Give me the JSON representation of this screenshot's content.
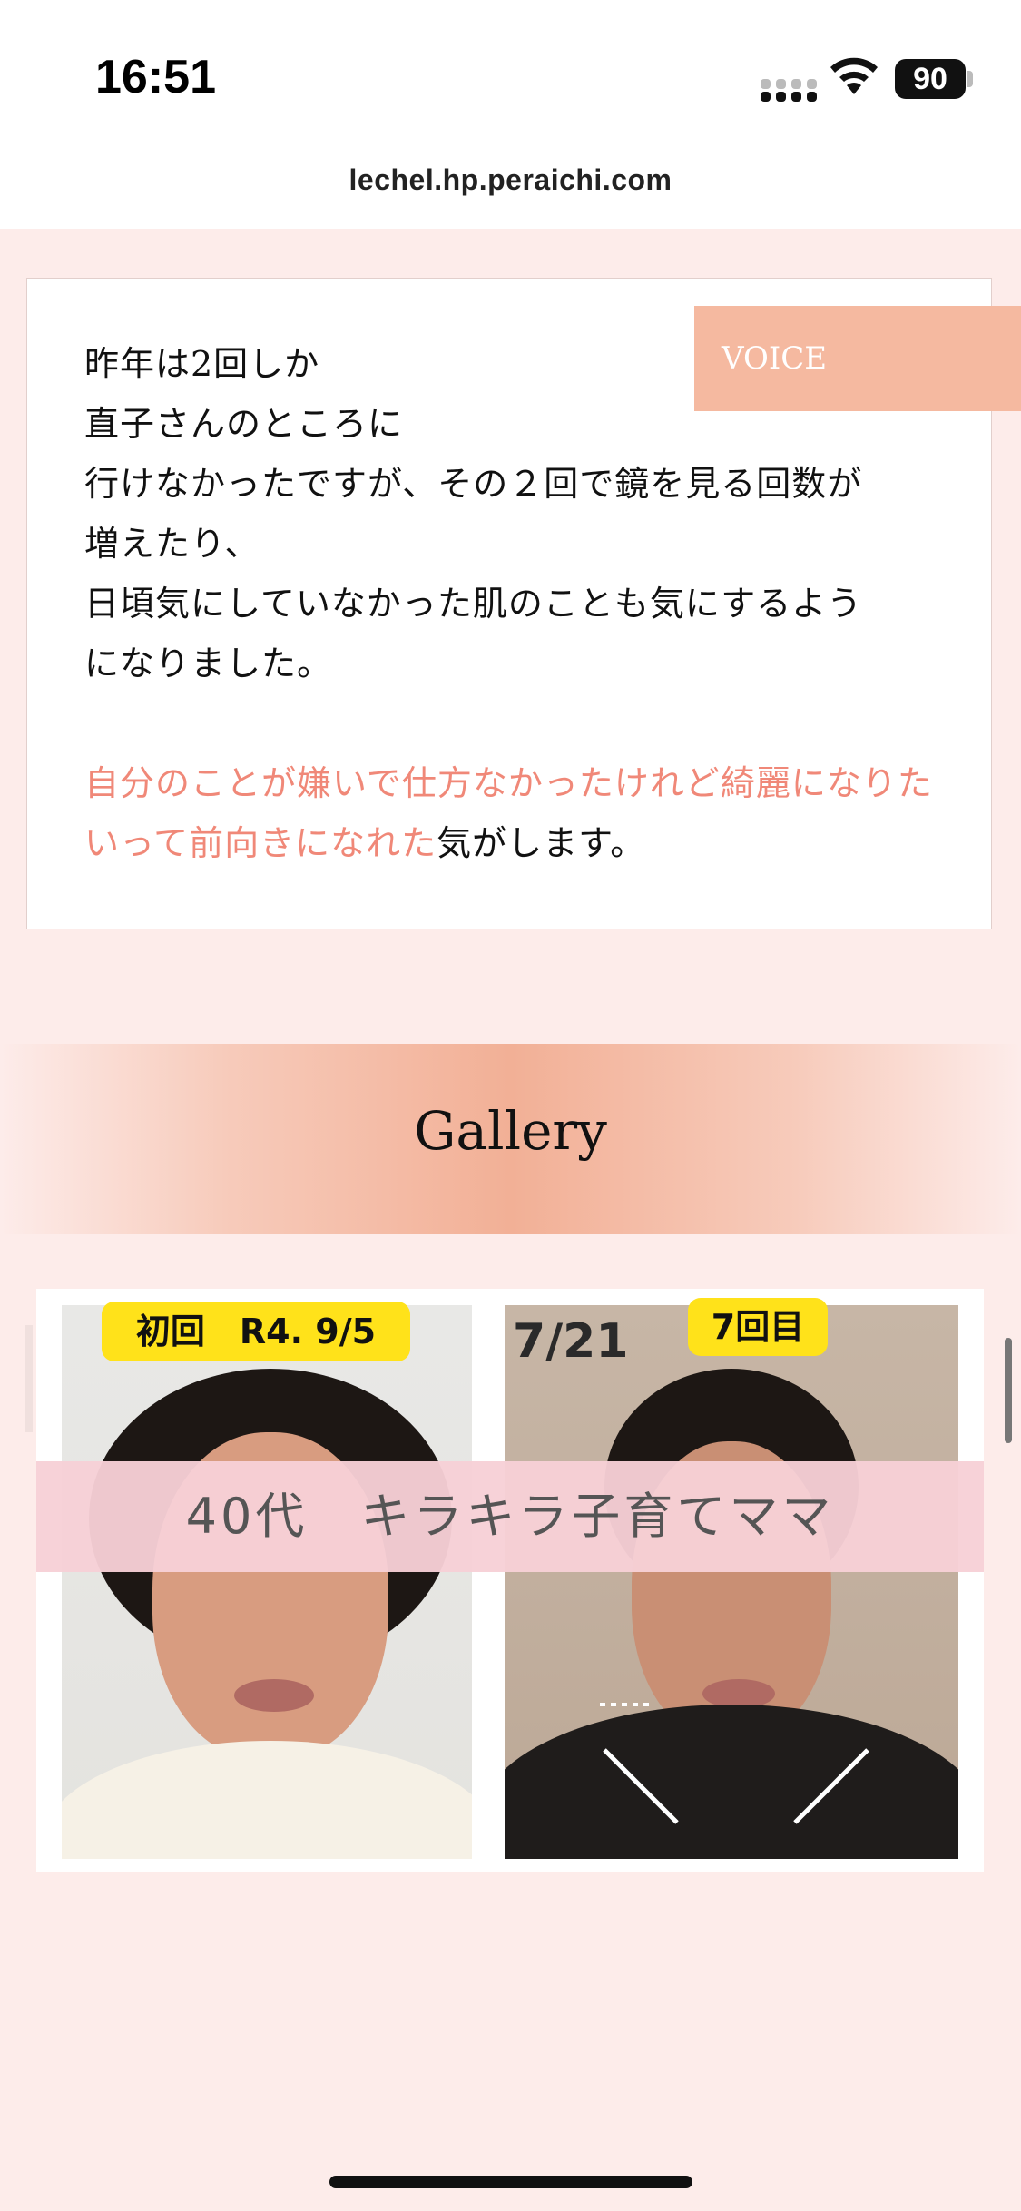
{
  "status_bar": {
    "time": "16:51",
    "battery": "90",
    "icons": [
      "signal-icon",
      "wifi-icon",
      "battery-icon"
    ]
  },
  "browser": {
    "url": "lechel.hp.peraichi.com"
  },
  "voice": {
    "tag": "VOICE",
    "lines": [
      "昨年は2回しか",
      "直子さんのところに",
      "行けなかったですが、その２回で鏡を見る回数が",
      "増えたり、",
      "日頃気にしていなかった肌のことも気にするよう",
      "になりました。"
    ],
    "highlight": "自分のことが嫌いで仕方なかったけれど綺麗になりたいって前向きになれた",
    "tail": "気がします。"
  },
  "gallery": {
    "title": "Gallery",
    "image": {
      "label_first": "初回　R4. 9/5",
      "date_right": "7/21",
      "label_seventh": "7回目",
      "caption": "40代　キラキラ子育てママ"
    }
  },
  "colors": {
    "background": "#fdecea",
    "accent": "#f5b9a0",
    "highlight_text": "#f08878"
  }
}
